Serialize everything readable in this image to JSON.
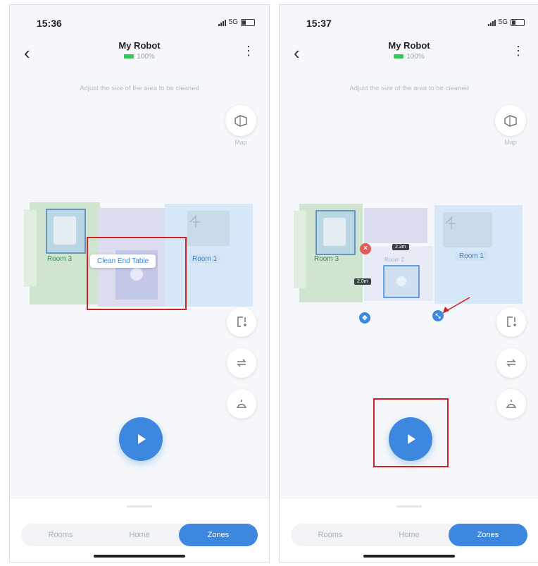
{
  "colors": {
    "accent": "#3d88de",
    "annotation": "#d32020",
    "battery": "#34c759"
  },
  "left": {
    "status": {
      "time": "15:36",
      "network": "5G"
    },
    "header": {
      "title": "My Robot",
      "battery": "100%"
    },
    "instruction": "Adjust the size of the area to be cleaned",
    "map_button_label": "Map",
    "rooms": [
      {
        "label": "Room 3"
      },
      {
        "label": "Room 1"
      }
    ],
    "popup": "Clean End Table",
    "tabs": [
      {
        "label": "Rooms"
      },
      {
        "label": "Home"
      },
      {
        "label": "Zones",
        "active": true
      }
    ]
  },
  "right": {
    "status": {
      "time": "15:37",
      "network": "5G"
    },
    "header": {
      "title": "My Robot",
      "battery": "100%"
    },
    "instruction": "Adjust the size of the area to be cleaned",
    "map_button_label": "Map",
    "rooms": [
      {
        "label": "Room 3"
      },
      {
        "label": "Room 1"
      },
      {
        "label": "Room 2"
      }
    ],
    "zone_width": "2.2m",
    "zone_height": "2.0m",
    "tabs": [
      {
        "label": "Rooms"
      },
      {
        "label": "Home"
      },
      {
        "label": "Zones",
        "active": true
      }
    ]
  },
  "icons": {
    "back": "chevron-left-icon",
    "menu": "more-vertical-icon",
    "map": "map-3d-icon",
    "add_zone": "add-zone-icon",
    "rotate": "rotate-icon",
    "robot": "robot-icon",
    "play": "play-icon",
    "delete": "close-icon",
    "move": "move-icon",
    "resize": "resize-icon"
  }
}
